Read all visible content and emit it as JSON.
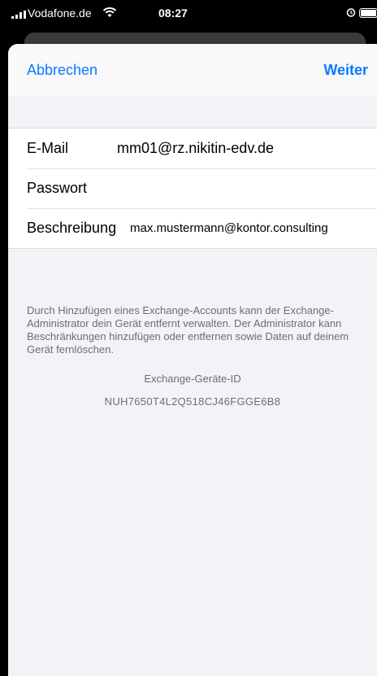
{
  "status_bar": {
    "carrier": "Vodafone.de",
    "time": "08:27",
    "icons": [
      "signal-icon",
      "wifi-icon",
      "alarm-icon",
      "battery-icon"
    ]
  },
  "nav": {
    "cancel_label": "Abbrechen",
    "next_label": "Weiter",
    "accent_color": "#0a7aff"
  },
  "form": {
    "email": {
      "label": "E-Mail",
      "value": "mm01@rz.nikitin-edv.de"
    },
    "password": {
      "label": "Passwort",
      "value": ""
    },
    "description": {
      "label": "Beschreibung",
      "value": "max.mustermann@kontor.consulting"
    }
  },
  "footer": {
    "note": "Durch Hinzufügen eines Exchange-Accounts kann der Exchange-Administrator dein Gerät entfernt verwalten. Der Administrator kann Beschränkungen hinzufügen oder entfernen sowie Daten auf deinem Gerät fernlöschen.",
    "device_id_label": "Exchange-Geräte-ID",
    "device_id": "NUH7650T4L2Q518CJ46FGGE6B8"
  }
}
